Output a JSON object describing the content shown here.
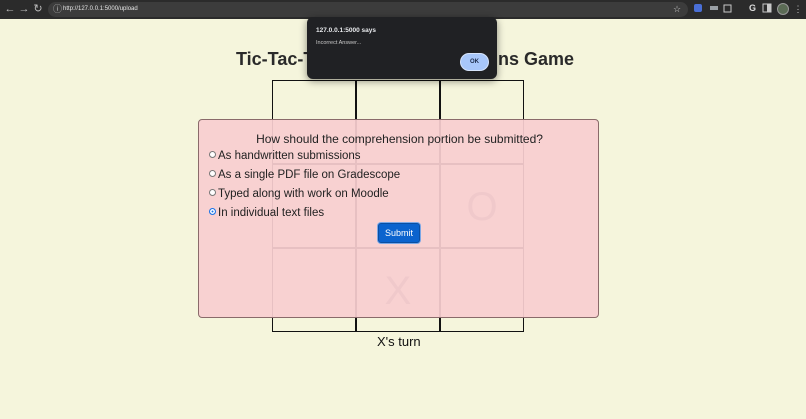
{
  "browser": {
    "url": "http://127.0.0.1:5000/upload",
    "back_icon": "←",
    "forward_icon": "→",
    "reload_icon": "↻",
    "site_info_icon": "ⓘ",
    "star_icon": "☆",
    "google_icon": "G"
  },
  "page": {
    "title_left": "Tic-Tac-To",
    "title_right": "ns Game",
    "turn_text": "X's turn"
  },
  "board": {
    "cells": [
      "",
      "",
      "",
      "",
      "",
      "O",
      "",
      "X",
      ""
    ]
  },
  "quiz": {
    "question": "How should the comprehension portion be submitted?",
    "options": [
      {
        "label": "As handwritten submissions",
        "selected": false
      },
      {
        "label": "As a single PDF file on Gradescope",
        "selected": false
      },
      {
        "label": "Typed along with work on Moodle",
        "selected": false
      },
      {
        "label": "In individual text files",
        "selected": true
      }
    ],
    "submit_label": "Submit"
  },
  "alert": {
    "title": "127.0.0.1:5000 says",
    "message": "Incorrect Answer...",
    "ok_label": "OK"
  },
  "colors": {
    "page_bg": "#f5f5dc",
    "modal_bg": "#f8cdd0",
    "submit_bg": "#0b63ce",
    "alert_bg": "#202124",
    "ok_bg": "#a8c7fa"
  }
}
